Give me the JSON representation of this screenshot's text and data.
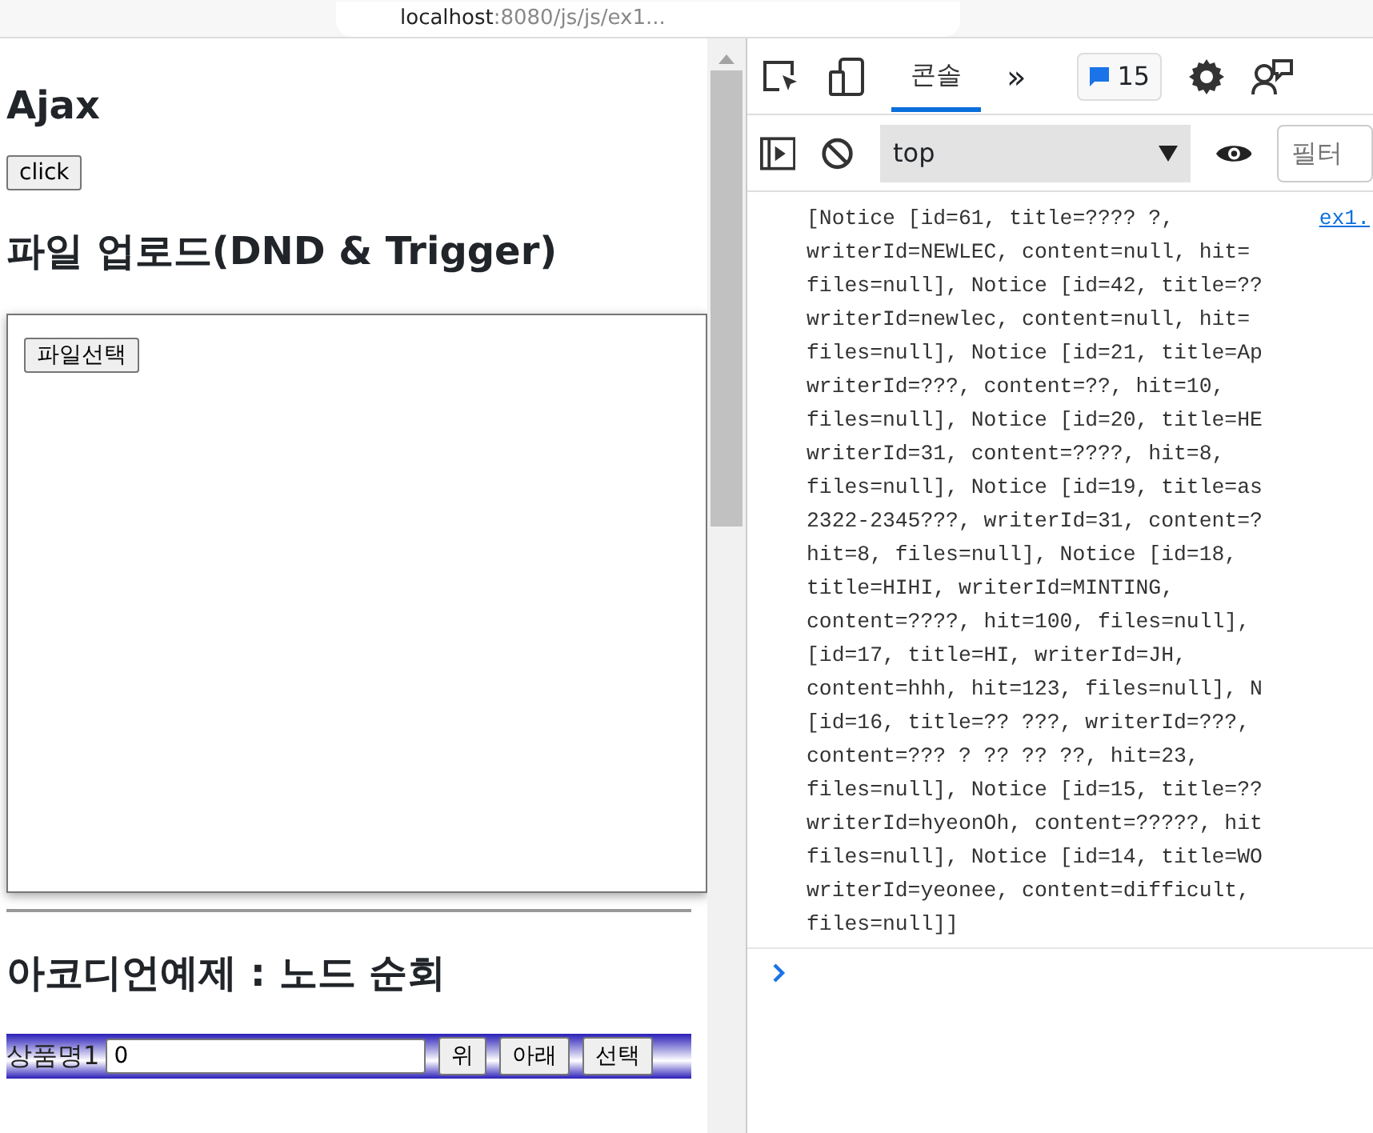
{
  "browser": {
    "url_host": "localhost",
    "url_rest": ":8080/js/js/ex1..."
  },
  "page": {
    "sections": [
      {
        "kind": "ajax",
        "heading": "Ajax",
        "button": "click"
      },
      {
        "kind": "upload",
        "heading": "파일 업로드(DND & Trigger)",
        "button": "파일선택"
      },
      {
        "kind": "accordion",
        "heading": "아코디언예제 : 노드 순회",
        "rows": [
          {
            "label": "상품명1",
            "value": "0",
            "buttons": [
              "위",
              "아래",
              "선택"
            ]
          }
        ]
      }
    ]
  },
  "devtools": {
    "tabs": [
      {
        "label": "콘솔",
        "selected": true
      }
    ],
    "more": "»",
    "issues_count": "15",
    "context": "top",
    "filter_placeholder": "필터",
    "messages": [
      {
        "source": "ex1.",
        "lines": [
          "[Notice [id=61, title=???? ?,",
          "writerId=NEWLEC, content=null, hit=",
          "files=null], Notice [id=42, title=??",
          "writerId=newlec, content=null, hit=",
          "files=null], Notice [id=21, title=Ap",
          "writerId=???, content=??, hit=10,",
          "files=null], Notice [id=20, title=HE",
          "writerId=31, content=????, hit=8,",
          "files=null], Notice [id=19, title=as",
          "2322-2345???, writerId=31, content=?",
          "hit=8, files=null], Notice [id=18,",
          "title=HIHI, writerId=MINTING,",
          "content=????, hit=100, files=null],",
          "[id=17, title=HI, writerId=JH,",
          "content=hhh, hit=123, files=null], N",
          "[id=16, title=?? ???, writerId=???,",
          "content=??? ? ?? ?? ??, hit=23,",
          "files=null], Notice [id=15, title=??",
          "writerId=hyeonOh, content=?????, hit",
          "files=null], Notice [id=14, title=WO",
          "writerId=yeonee, content=difficult,",
          "files=null]]"
        ]
      }
    ]
  }
}
